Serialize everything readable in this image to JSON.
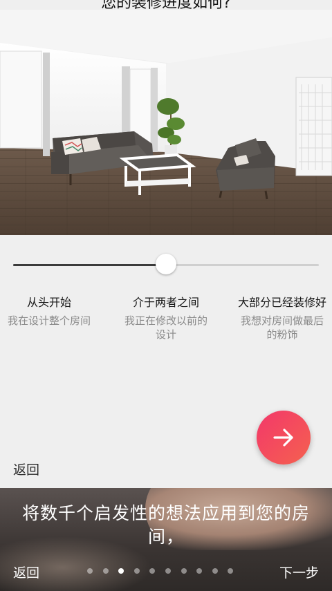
{
  "header": {
    "title": "您的装修进度如何?"
  },
  "hero": {
    "image_name": "living-room-illustration"
  },
  "slider": {
    "value": 0.5
  },
  "options": [
    {
      "label": "从头开始",
      "desc": "我在设计整个房间"
    },
    {
      "label": "介于两者之间",
      "desc": "我正在修改以前的设计"
    },
    {
      "label": "大部分已经装修好",
      "desc": "我想对房间做最后的粉饰"
    }
  ],
  "actions": {
    "next_icon": "arrow-right-icon",
    "back_label": "返回"
  },
  "onboarding": {
    "headline": "将数千个启发性的想法应用到您的房间，",
    "back_label": "返回",
    "next_label": "下一步",
    "page_count": 10,
    "active_page": 3
  },
  "colors": {
    "accent_start": "#f3386a",
    "accent_end": "#f4614f",
    "slider_fill": "#3b3b3b"
  }
}
